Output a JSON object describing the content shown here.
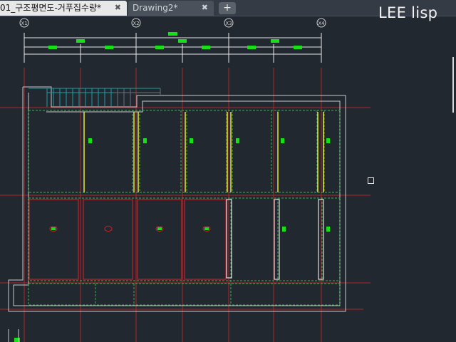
{
  "tabs": [
    {
      "label": "01_구조평면도-거푸집수량*",
      "close_icon": "close-icon",
      "active": true
    },
    {
      "label": "Drawing2*",
      "close_icon": "close-icon",
      "active": false
    }
  ],
  "new_tab_icon": "plus-icon",
  "brand_label": "LEE lisp",
  "grid_labels": [
    "X1",
    "X2",
    "X3",
    "X4"
  ],
  "colors": {
    "background": "#212830",
    "grid_axis": "#c0262a",
    "wall": "#c9c9c9",
    "beam": "#e8e82a",
    "slab": "#c8202a",
    "dashed": "#38b04a",
    "marker": "#18e018",
    "stair": "#1e9ca0"
  }
}
